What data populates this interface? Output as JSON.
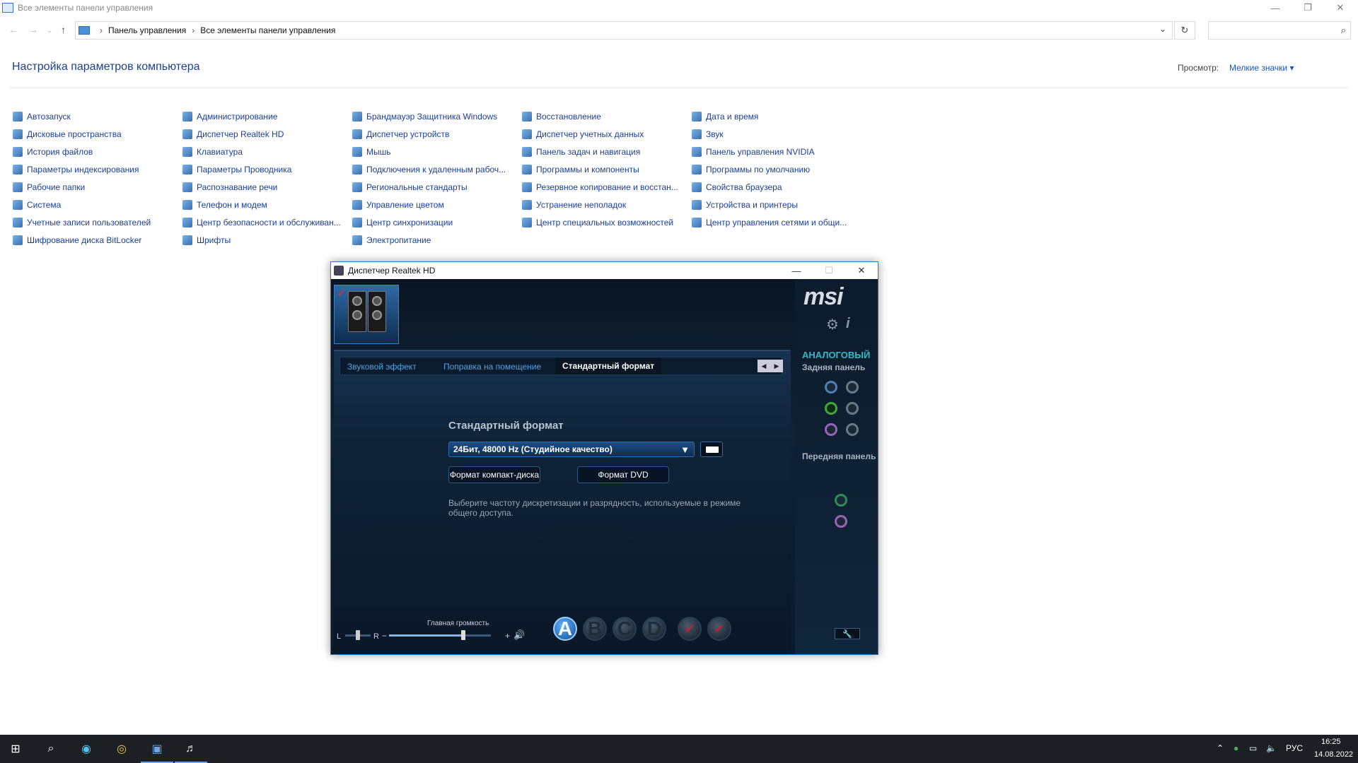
{
  "window": {
    "title": "Все элементы панели управления"
  },
  "address": {
    "crumb1": "Панель управления",
    "crumb2": "Все элементы панели управления",
    "search_placeholder": ""
  },
  "page": {
    "title": "Настройка параметров компьютера",
    "view_label": "Просмотр:",
    "view_value": "Мелкие значки ▾"
  },
  "items": [
    [
      "Автозапуск",
      "Администрирование",
      "Брандмауэр Защитника Windows",
      "Восстановление",
      "Дата и время"
    ],
    [
      "Дисковые пространства",
      "Диспетчер Realtek HD",
      "Диспетчер устройств",
      "Диспетчер учетных данных",
      "Звук"
    ],
    [
      "История файлов",
      "Клавиатура",
      "Мышь",
      "Панель задач и навигация",
      "Панель управления NVIDIA"
    ],
    [
      "Параметры индексирования",
      "Параметры Проводника",
      "Подключения к удаленным рабоч...",
      "Программы и компоненты",
      "Программы по умолчанию"
    ],
    [
      "Рабочие папки",
      "Распознавание речи",
      "Региональные стандарты",
      "Резервное копирование и восстан...",
      "Свойства браузера"
    ],
    [
      "Система",
      "Телефон и модем",
      "Управление цветом",
      "Устранение неполадок",
      "Устройства и принтеры"
    ],
    [
      "Учетные записи пользователей",
      "Центр безопасности и обслуживан...",
      "Центр синхронизации",
      "Центр специальных возможностей",
      "Центр управления сетями и общи..."
    ],
    [
      "Шифрование диска BitLocker",
      "Шрифты",
      "Электропитание"
    ]
  ],
  "realtek": {
    "title": "Диспетчер Realtek HD",
    "tabs": [
      "Звуковой эффект",
      "Поправка на помещение",
      "Стандартный формат"
    ],
    "section": "Стандартный формат",
    "format": "24Бит, 48000 Hz (Студийное качество)",
    "btn_cd": "Формат компакт-диска",
    "btn_dvd": "Формат DVD",
    "hint": "Выберите частоту дискретизации и разрядность, используемые в режиме общего доступа.",
    "vol_label": "Главная громкость",
    "vol_l": "L",
    "vol_r": "R",
    "logo": "msi",
    "analog": "АНАЛОГОВЫЙ",
    "rear": "Задняя панель",
    "front": "Передняя панель",
    "btns": [
      "A",
      "B",
      "C",
      "D"
    ],
    "master_volume": 0.73,
    "balance": 0.5
  },
  "tray": {
    "lang": "РУС",
    "time": "16:25",
    "date": "14.08.2022"
  }
}
